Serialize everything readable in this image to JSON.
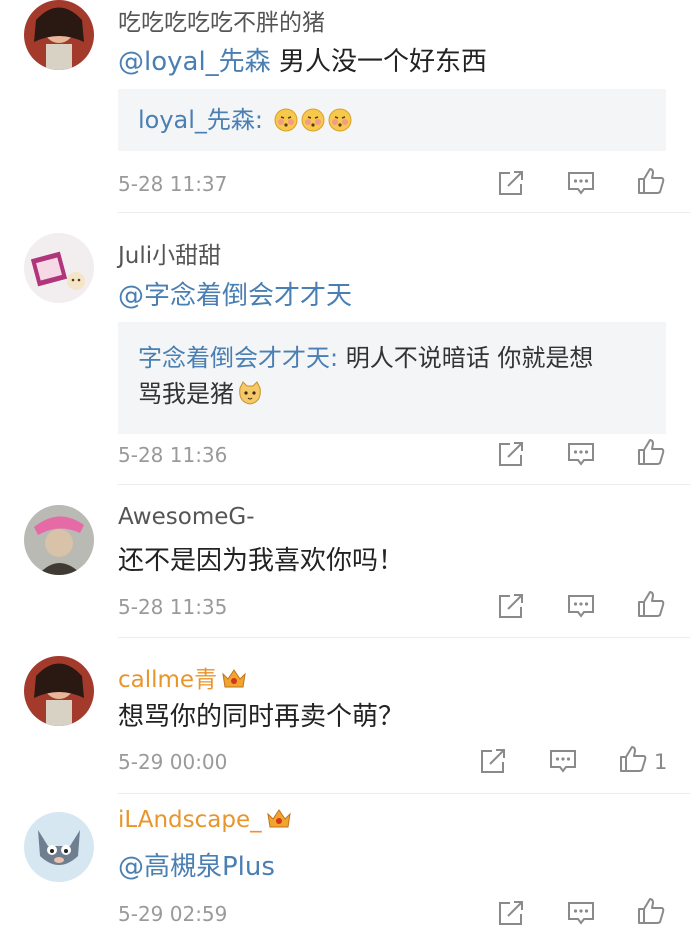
{
  "comments": [
    {
      "username": "吃吃吃吃吃不胖的猪",
      "mention": "@loyal_先森",
      "text": "男人没一个好东西",
      "quote": {
        "name": "loyal_先森:",
        "text": ""
      },
      "time": "5-28 11:37",
      "likes": ""
    },
    {
      "username": "Juli小甜甜",
      "mention": "@字念着倒会才才天",
      "text": "",
      "quote": {
        "name": "字念着倒会才才天:",
        "text": "明人不说暗话 你就是想",
        "text2": "骂我是猪"
      },
      "time": "5-28 11:36",
      "likes": ""
    },
    {
      "username": "AwesomeG-",
      "mention": "",
      "text": "还不是因为我喜欢你吗！",
      "time": "5-28 11:35",
      "likes": ""
    },
    {
      "username": "callme青",
      "mention": "",
      "text": "想骂你的同时再卖个萌？",
      "time": "5-29 00:00",
      "likes": "1"
    },
    {
      "username": "iLAndscape_",
      "mention": "@高槻泉Plus",
      "text": "",
      "time": "5-29 02:59",
      "likes": ""
    }
  ],
  "colors": {
    "mention": "#4a7fb3",
    "vip_name": "#e8952b",
    "quote_bg": "#f4f5f7",
    "time": "#9a9a9a"
  },
  "icons": [
    "repost-icon",
    "comment-icon",
    "like-icon",
    "crown-icon",
    "blush-emoji",
    "cat-emoji"
  ]
}
